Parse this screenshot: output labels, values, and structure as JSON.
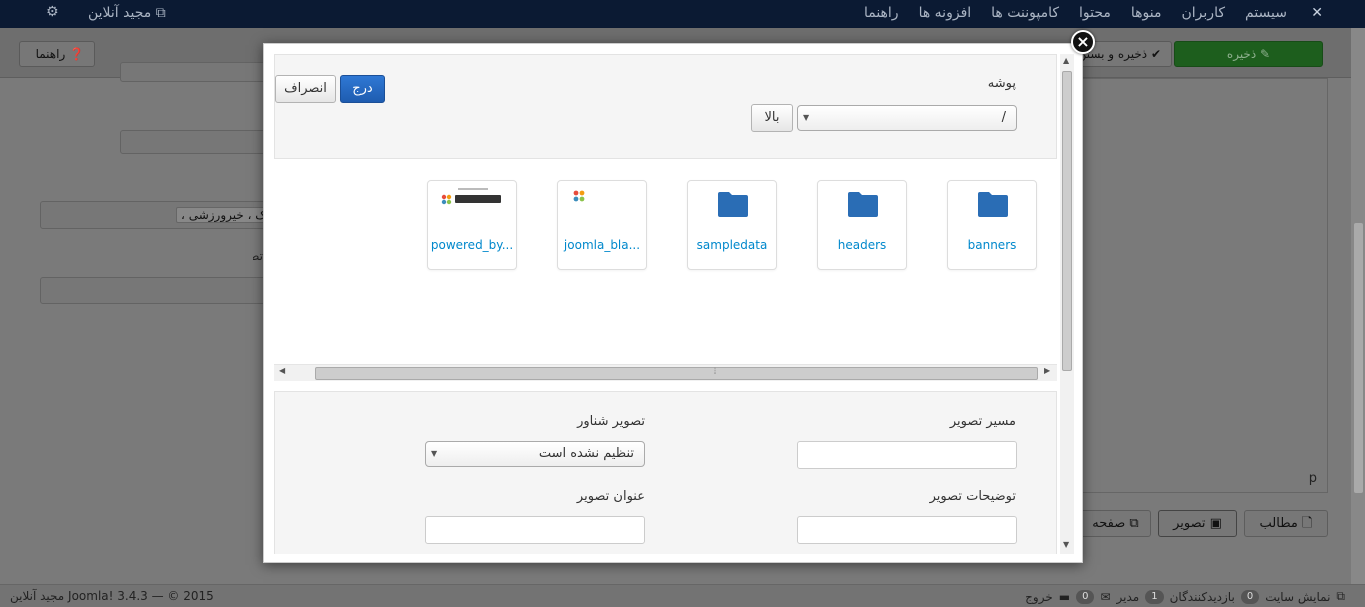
{
  "topbar": {
    "menu": [
      "سیستم",
      "کاربران",
      "منوها",
      "محتوا",
      "کامپوننت ها",
      "افزونه ها",
      "راهنما"
    ],
    "user": "مجید آنلاین"
  },
  "toolbar": {
    "help_label": "راهنما",
    "save_label": "ذخیره",
    "save_close_label": "ذخیره و بستن"
  },
  "background": {
    "tags_value": "جراحی زیبایی ، جراحی پلاستیک ، خیرورزشی ،",
    "partial_label": "تصویر صفحه",
    "editor_p": "p",
    "bottom_buttons": [
      "مطالب",
      "تصویر",
      "صفحه"
    ]
  },
  "statusbar": {
    "copyright": "Joomla! 3.4.3 — © 2015 مجید آنلاین",
    "view_site": "نمایش سایت",
    "visitors_label": "بازدیدکنندگان",
    "visitors_count": "0",
    "admins_label": "مدیر",
    "admins_count": "1",
    "messages_count": "0",
    "logout": "خروج"
  },
  "modal": {
    "folder_label": "پوشه",
    "folder_value": "/",
    "up_button": "بالا",
    "insert_button": "درج",
    "cancel_button": "انصراف",
    "tiles": [
      {
        "name": "banners",
        "type": "folder"
      },
      {
        "name": "headers",
        "type": "folder"
      },
      {
        "name": "sampledata",
        "type": "folder"
      },
      {
        "name": "joomla_bla...",
        "type": "image"
      },
      {
        "name": "powered_by...",
        "type": "image"
      }
    ],
    "image_url_label": "مسیر تصویر",
    "float_label": "تصویر شناور",
    "float_value": "تنظیم نشده است",
    "description_label": "توضیحات تصویر",
    "title_label": "عنوان تصویر"
  },
  "colors": {
    "topbar": "#0b1a33",
    "primary": "#2f78d4",
    "folder": "#2a6db5",
    "link": "#0088cc",
    "save_green": "#1d5e1d"
  }
}
